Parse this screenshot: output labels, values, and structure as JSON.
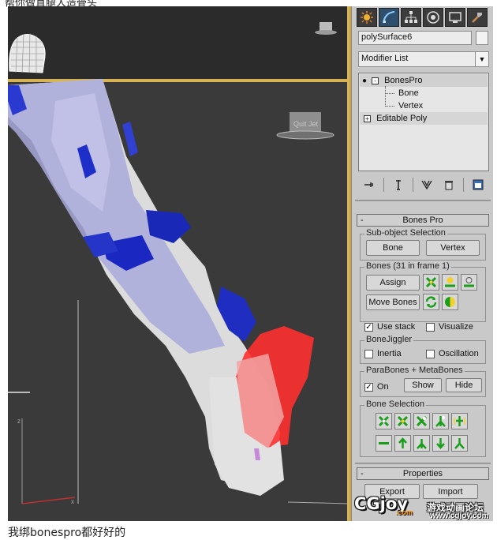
{
  "top_caption": "帮你做直腿人造骨头",
  "viewport": {
    "hat_label": "Quit Jet"
  },
  "command_panel": {
    "tabs": [
      {
        "name": "create-icon"
      },
      {
        "name": "modify-icon"
      },
      {
        "name": "hierarchy-icon"
      },
      {
        "name": "motion-icon"
      },
      {
        "name": "display-icon"
      },
      {
        "name": "utilities-icon"
      }
    ],
    "object_name": "polySurface6",
    "modifier_list_label": "Modifier List",
    "stack": {
      "modifier": "BonesPro",
      "sub_items": [
        "Bone",
        "Vertex"
      ],
      "base": "Editable Poly"
    },
    "bones_pro": {
      "title": "Bones Pro",
      "sub_object_label": "Sub-object Selection",
      "bone_btn": "Bone",
      "vertex_btn": "Vertex",
      "bones_group_label": "Bones (31 in frame 1)",
      "assign_btn": "Assign",
      "move_bones_btn": "Move Bones",
      "use_stack": "Use stack",
      "use_stack_checked": true,
      "visualize": "Visualize",
      "visualize_checked": false,
      "bonejiggler_label": "BoneJiggler",
      "inertia": "Inertia",
      "inertia_checked": false,
      "oscillation": "Oscillation",
      "oscillation_checked": false,
      "parabones_label": "ParaBones + MetaBones",
      "on": "On",
      "on_checked": true,
      "show_btn": "Show",
      "hide_btn": "Hide",
      "bone_selection_label": "Bone Selection"
    },
    "properties": {
      "title": "Properties",
      "export_btn": "Export",
      "import_btn": "Import"
    }
  },
  "watermark": {
    "logo": "CGjoy",
    "com": ".com",
    "title": "游戏动画论坛",
    "url": "www.cgjoy.com"
  },
  "bottom_caption": "我绑bonespro都好好的"
}
